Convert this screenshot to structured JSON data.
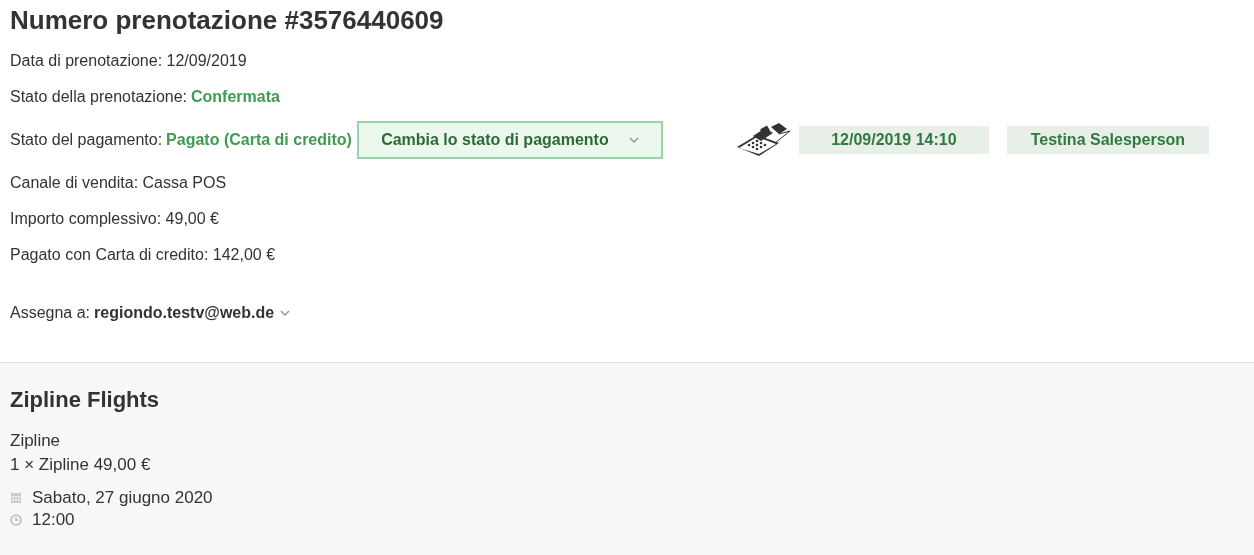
{
  "title": "Numero prenotazione #3576440609",
  "booking_date": {
    "label": "Data di prenotazione:",
    "value": "12/09/2019"
  },
  "booking_status": {
    "label": "Stato della prenotazione:",
    "value": "Confermata"
  },
  "payment_status": {
    "label": "Stato del pagamento:",
    "value": "Pagato (Carta di credito)",
    "button": "Cambia lo stato di pagamento",
    "timestamp": "12/09/2019 14:10",
    "salesperson": "Testina Salesperson"
  },
  "details": [
    {
      "label": "Canale di vendita:",
      "value": "Cassa POS"
    },
    {
      "label": "Importo complessivo:",
      "value": "49,00 €"
    },
    {
      "label": "Pagato con Carta di credito:",
      "value": " 142,00 €"
    }
  ],
  "assign": {
    "label": "Assegna a:",
    "value": "regiondo.testv@web.de"
  },
  "product": {
    "title": "Zipline Flights",
    "name": "Zipline",
    "line": "1 × Zipline 49,00 €",
    "date": "Sabato, 27 giugno 2020",
    "time": "12:00"
  }
}
